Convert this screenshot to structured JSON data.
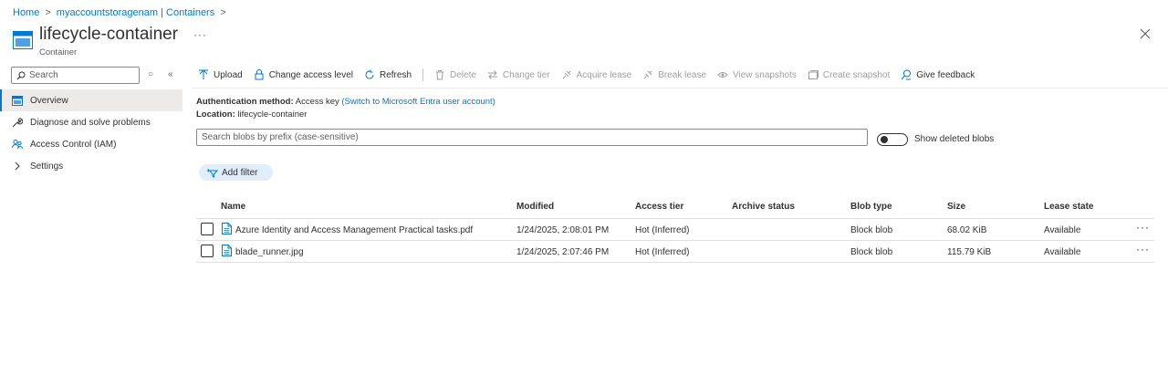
{
  "breadcrumb": {
    "home": "Home",
    "storage": "myaccountstoragenam | Containers"
  },
  "header": {
    "title": "lifecycle-container",
    "subtitle": "Container",
    "more": "···"
  },
  "sidebar": {
    "search_placeholder": "Search",
    "items": [
      {
        "label": "Overview",
        "icon": "overview-icon"
      },
      {
        "label": "Diagnose and solve problems",
        "icon": "wrench-icon"
      },
      {
        "label": "Access Control (IAM)",
        "icon": "people-icon"
      },
      {
        "label": "Settings",
        "icon": "chevron-right-icon"
      }
    ]
  },
  "toolbar": {
    "upload": "Upload",
    "change_access_level": "Change access level",
    "refresh": "Refresh",
    "delete": "Delete",
    "change_tier": "Change tier",
    "acquire_lease": "Acquire lease",
    "break_lease": "Break lease",
    "view_snapshots": "View snapshots",
    "create_snapshot": "Create snapshot",
    "give_feedback": "Give feedback"
  },
  "info": {
    "auth_label": "Authentication method:",
    "auth_value": "Access key",
    "auth_link": "(Switch to Microsoft Entra user account)",
    "location_label": "Location:",
    "location_value": "lifecycle-container"
  },
  "filter": {
    "prefix_placeholder": "Search blobs by prefix (case-sensitive)",
    "show_deleted_label": "Show deleted blobs",
    "add_filter": "Add filter"
  },
  "table": {
    "columns": [
      "Name",
      "Modified",
      "Access tier",
      "Archive status",
      "Blob type",
      "Size",
      "Lease state"
    ],
    "rows": [
      {
        "name": "Azure Identity and Access Management Practical tasks.pdf",
        "modified": "1/24/2025, 2:08:01 PM",
        "access_tier": "Hot (Inferred)",
        "archive_status": "",
        "blob_type": "Block blob",
        "size": "68.02 KiB",
        "lease_state": "Available"
      },
      {
        "name": "blade_runner.jpg",
        "modified": "1/24/2025, 2:07:46 PM",
        "access_tier": "Hot (Inferred)",
        "archive_status": "",
        "blob_type": "Block blob",
        "size": "115.79 KiB",
        "lease_state": "Available"
      }
    ],
    "more": "···"
  },
  "colors": {
    "accent": "#0078d4",
    "pill": "#e1edf9",
    "active_nav": "#edebe9"
  }
}
